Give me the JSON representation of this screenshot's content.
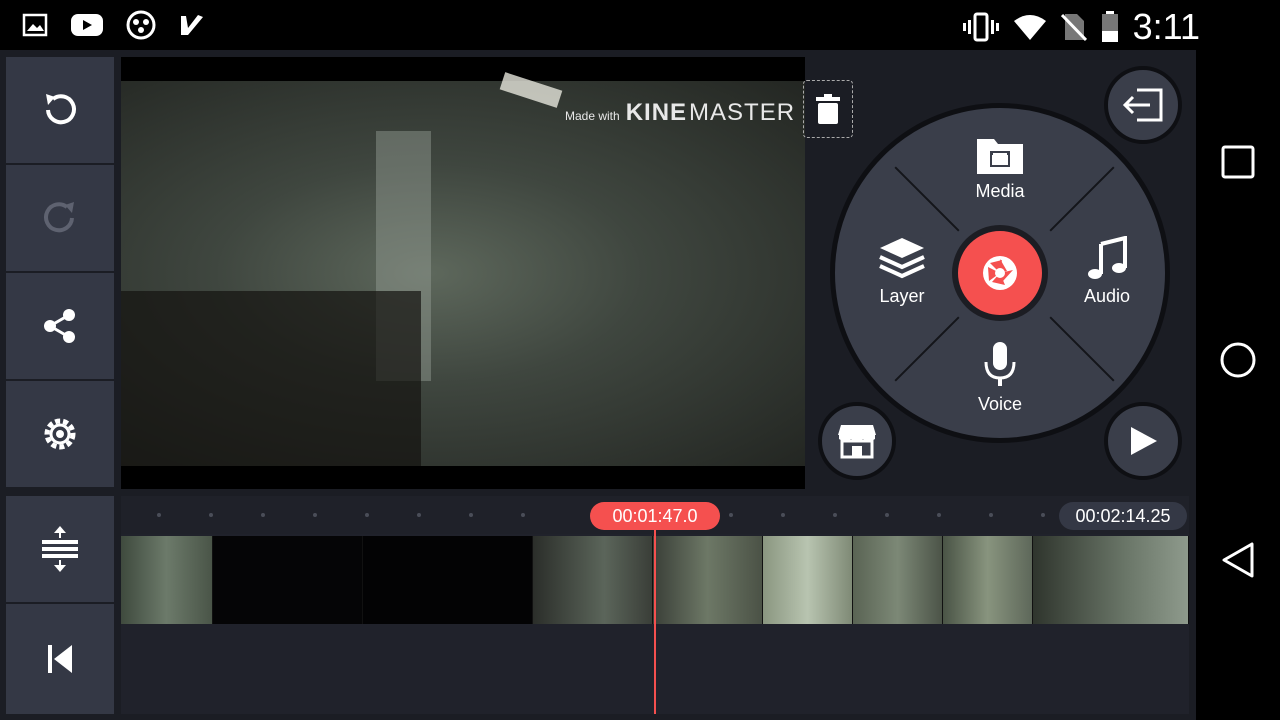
{
  "status_bar": {
    "time": "3:11",
    "left_icons": [
      "gallery-icon",
      "youtube-icon",
      "app-icon",
      "check-icon"
    ],
    "right_icons": [
      "vibrate-icon",
      "wifi-icon",
      "no-sim-icon",
      "battery-icon"
    ]
  },
  "left_toolbar": {
    "items": [
      "undo-icon",
      "redo-icon",
      "share-icon",
      "settings-icon"
    ],
    "bottom_items": [
      "timeline-expand-icon",
      "skip-to-start-icon"
    ]
  },
  "preview": {
    "watermark_prefix": "Made with",
    "watermark_kine": "KINE",
    "watermark_master": "MASTER"
  },
  "radial_menu": {
    "media_label": "Media",
    "layer_label": "Layer",
    "audio_label": "Audio",
    "voice_label": "Voice"
  },
  "timeline": {
    "current_time": "00:01:47.0",
    "total_duration": "00:02:14.25"
  },
  "colors": {
    "accent": "#f5504f",
    "panel": "#343845",
    "background": "#1b1d24"
  }
}
